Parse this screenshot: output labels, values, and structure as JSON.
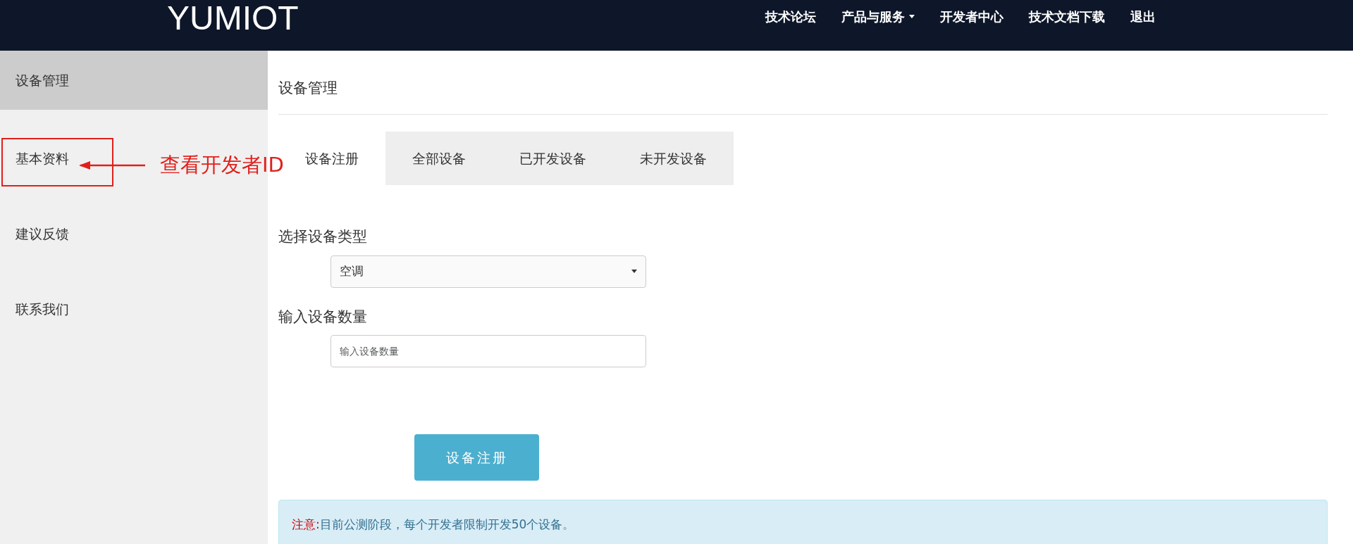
{
  "navbar": {
    "brand": "YUMIOT",
    "items": [
      {
        "label": "技术论坛",
        "dropdown": false
      },
      {
        "label": "产品与服务",
        "dropdown": true
      },
      {
        "label": "开发者中心",
        "dropdown": false
      },
      {
        "label": "技术文档下载",
        "dropdown": false
      },
      {
        "label": "退出",
        "dropdown": false
      }
    ]
  },
  "sidebar": {
    "items": [
      {
        "label": "设备管理",
        "selected": true
      },
      {
        "label": "基本资料",
        "selected": false
      },
      {
        "label": "建议反馈",
        "selected": false
      },
      {
        "label": "联系我们",
        "selected": false
      }
    ]
  },
  "annotation": {
    "text": "查看开发者ID"
  },
  "main": {
    "title": "设备管理",
    "tabs": [
      {
        "label": "设备注册",
        "selected": true
      },
      {
        "label": "全部设备",
        "selected": false
      },
      {
        "label": "已开发设备",
        "selected": false
      },
      {
        "label": "未开发设备",
        "selected": false
      }
    ],
    "device_type": {
      "label": "选择设备类型",
      "value": "空调"
    },
    "device_count": {
      "label": "输入设备数量",
      "placeholder": "输入设备数量"
    },
    "submit_button": "设备注册",
    "alert": {
      "prefix": "注意:",
      "text": "目前公测阶段，每个开发者限制开发50个设备。"
    }
  }
}
